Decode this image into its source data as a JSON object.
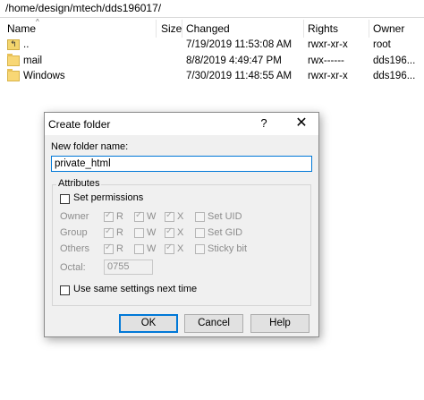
{
  "path": "/home/design/mtech/dds196017/",
  "columns": [
    "Name",
    "Size",
    "Changed",
    "Rights",
    "Owner"
  ],
  "files": [
    {
      "name": "..",
      "size": "",
      "changed": "7/19/2019 11:53:08 AM",
      "rights": "rwxr-xr-x",
      "owner": "root",
      "icon": "parent-folder-icon"
    },
    {
      "name": "mail",
      "size": "",
      "changed": "8/8/2019 4:49:47 PM",
      "rights": "rwx------",
      "owner": "dds196...",
      "icon": "folder-icon"
    },
    {
      "name": "Windows",
      "size": "",
      "changed": "7/30/2019 11:48:55 AM",
      "rights": "rwxr-xr-x",
      "owner": "dds196...",
      "icon": "folder-icon"
    }
  ],
  "dialog": {
    "title": "Create folder",
    "help": "?",
    "close": "✕",
    "name_label": "New folder name:",
    "name_value": "private_html",
    "attributes_label": "Attributes",
    "set_permissions": "Set permissions",
    "set_permissions_checked": false,
    "perm_rows": [
      {
        "label": "Owner",
        "r": true,
        "w": true,
        "x": true,
        "extra": "Set UID"
      },
      {
        "label": "Group",
        "r": true,
        "w": false,
        "x": true,
        "extra": "Set GID"
      },
      {
        "label": "Others",
        "r": true,
        "w": false,
        "x": true,
        "extra": "Sticky bit"
      }
    ],
    "perm_letters": [
      "R",
      "W",
      "X"
    ],
    "octal_label": "Octal:",
    "octal_value": "0755",
    "same_settings": "Use same settings next time",
    "same_settings_checked": false,
    "buttons": {
      "ok": "OK",
      "cancel": "Cancel",
      "help": "Help"
    }
  }
}
